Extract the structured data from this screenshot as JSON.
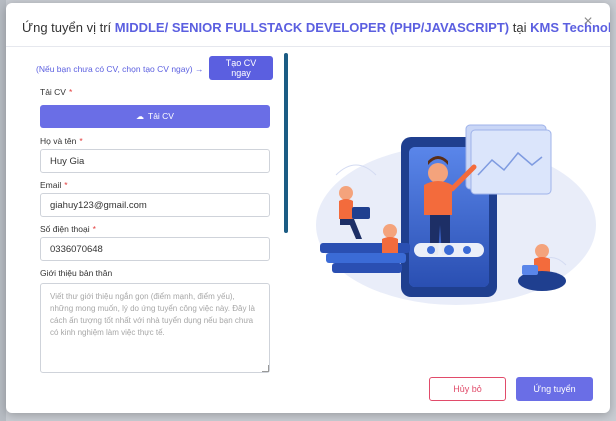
{
  "modal": {
    "title_prefix": "Ứng tuyển vị trí",
    "job_title": "MIDDLE/ SENIOR FULLSTACK DEVELOPER (PHP/JAVASCRIPT)",
    "title_connector": "tại",
    "company": "KMS Technology",
    "close_symbol": "×"
  },
  "form": {
    "no_cv_hint": "(Nếu bạn chưa có CV, chọn tạo CV ngay) →",
    "create_cv_label": "Tạo CV ngay",
    "upload_cv_label": "Tải CV",
    "upload_button_label": "Tải CV",
    "fullname_label": "Họ và tên",
    "fullname_value": "Huy Gia",
    "email_label": "Email",
    "email_value": "giahuy123@gmail.com",
    "phone_label": "Số điện thoại",
    "phone_value": "0336070648",
    "intro_label": "Giới thiệu bản thân",
    "intro_placeholder": "Viết thư giới thiệu ngắn gọn (điểm mạnh, điểm yếu), những mong muốn, lý do ứng tuyển công việc này. Đây là cách ấn tượng tốt nhất với nhà tuyển dụng nếu bạn chưa có kinh nghiệm làm việc thực tế.",
    "required_mark": "*"
  },
  "actions": {
    "cancel_label": "Hủy bỏ",
    "submit_label": "Ứng tuyển"
  },
  "colors": {
    "accent": "#5b5fe0",
    "button_primary": "#6a6ee6",
    "cancel": "#e14b6a",
    "required": "#e33c3c"
  }
}
